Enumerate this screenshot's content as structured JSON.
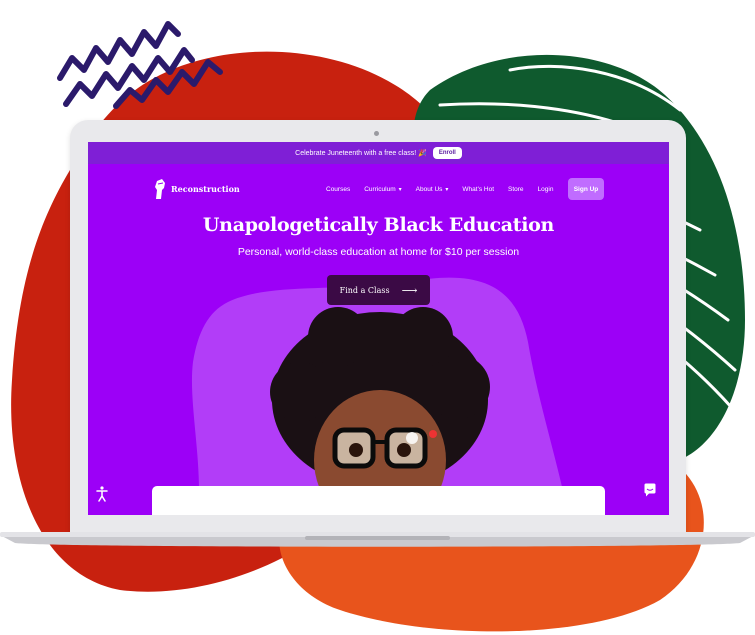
{
  "announcement": {
    "text": "Celebrate Juneteenth with a free class! 🎉",
    "button": "Enroll"
  },
  "brand": {
    "name": "Reconstruction"
  },
  "nav": {
    "items": [
      {
        "label": "Courses",
        "dropdown": false
      },
      {
        "label": "Curriculum",
        "dropdown": true
      },
      {
        "label": "About Us",
        "dropdown": true
      },
      {
        "label": "What's Hot",
        "dropdown": false
      },
      {
        "label": "Store",
        "dropdown": false
      },
      {
        "label": "Login",
        "dropdown": false
      }
    ],
    "cta": "Sign Up"
  },
  "hero": {
    "title": "Unapologetically Black Education",
    "subtitle": "Personal, world-class education at home for $10 per session",
    "cta": "Find a Class",
    "cta_icon": "arrow-right-icon"
  },
  "icons": {
    "accessibility": "accessibility-icon",
    "chat": "chat-icon",
    "caret": "▾",
    "arrow": "⟶"
  },
  "colors": {
    "screen_bg": "#9c00f7",
    "announcement_bg": "#7f1fd6",
    "cta_bg": "#3b0a45",
    "signup_bg": "#c06cff",
    "blob_red": "#c8210f",
    "blob_green": "#0f5a2e",
    "blob_orange": "#e8541c",
    "squiggle": "#2b1a6b"
  }
}
